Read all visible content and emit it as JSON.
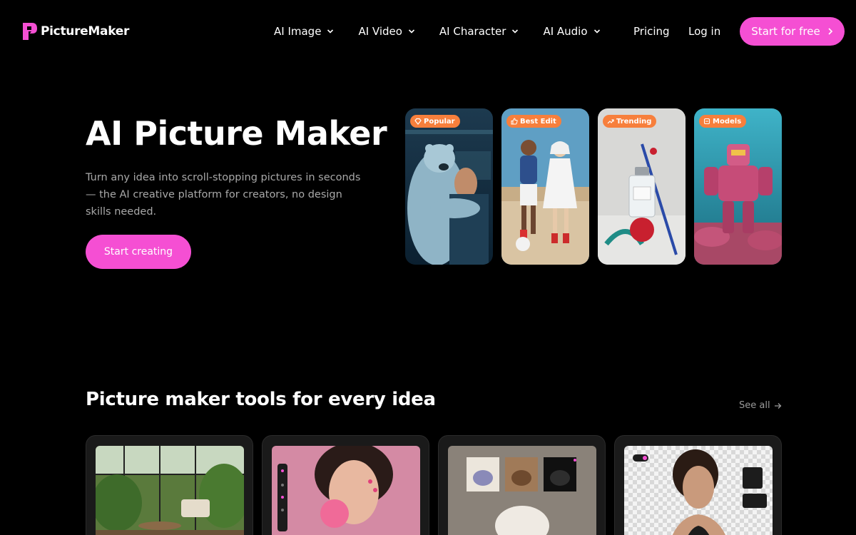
{
  "brand": {
    "name": "PictureMaker",
    "accent": "#f54fd3",
    "badge_color": "#f77f3c"
  },
  "nav": {
    "menu": [
      {
        "label": "AI Image",
        "icon": "chevron-down-icon"
      },
      {
        "label": "AI Video",
        "icon": "chevron-down-icon"
      },
      {
        "label": "AI Character",
        "icon": "chevron-down-icon"
      },
      {
        "label": "AI Audio",
        "icon": "chevron-down-icon"
      }
    ],
    "pricing": "Pricing",
    "login": "Log in",
    "cta": "Start for free"
  },
  "hero": {
    "title": "AI Picture Maker",
    "description": "Turn any idea into scroll-stopping pictures in seconds — the AI creative platform for creators, no design skills needed.",
    "cta": "Start creating",
    "cards": [
      {
        "badge": "Popular",
        "icon": "diamond-icon",
        "image": "polar-bear-hug-image"
      },
      {
        "badge": "Best Edit",
        "icon": "thumbs-up-icon",
        "image": "fashion-duo-image"
      },
      {
        "badge": "Trending",
        "icon": "trending-up-icon",
        "image": "perfume-bottle-image"
      },
      {
        "badge": "Models",
        "icon": "model-cube-icon",
        "image": "underwater-robot-image"
      }
    ]
  },
  "tools": {
    "title": "Picture maker tools for every idea",
    "see_all": "See all",
    "cards": [
      {
        "image": "greenhouse-interior-image"
      },
      {
        "image": "bubblegum-portrait-editor-image"
      },
      {
        "image": "teapot-variations-image"
      },
      {
        "image": "background-removal-portrait-image"
      }
    ]
  }
}
